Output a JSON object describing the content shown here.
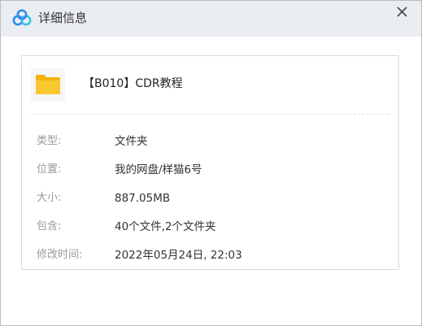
{
  "window": {
    "title": "详细信息",
    "close_glyph": "✕",
    "logo_icon": "baidu-netdisk-logo",
    "close_icon": "close-icon"
  },
  "file": {
    "icon": "folder-icon",
    "icon_color": "#f9c82e",
    "name": "【B010】CDR教程"
  },
  "details": [
    {
      "label": "类型:",
      "value": "文件夹"
    },
    {
      "label": "位置:",
      "value": "我的网盘/样猫6号"
    },
    {
      "label": "大小:",
      "value": "887.05MB"
    },
    {
      "label": "包含:",
      "value": "40个文件,2个文件夹"
    },
    {
      "label": "修改时间:",
      "value": "2022年05月24日, 22:03"
    }
  ],
  "colors": {
    "titlebar_bg": "#eaedf2",
    "logo_blue": "#2f8cf0",
    "logo_cyan": "#3fc1e8",
    "label_gray": "#9a9a9a",
    "value_dark": "#333333"
  }
}
